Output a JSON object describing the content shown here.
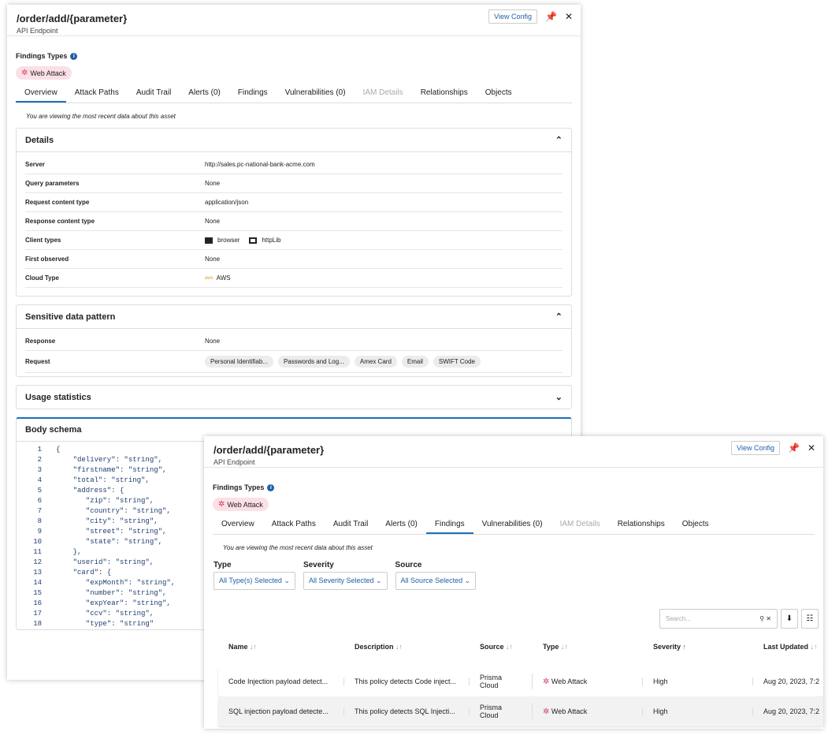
{
  "endpoint": {
    "title": "/order/add/{parameter}",
    "subtitle": "API Endpoint",
    "view_config": "View Config",
    "findings_types": "Findings Types",
    "chip": "Web Attack"
  },
  "tabs": [
    "Overview",
    "Attack Paths",
    "Audit Trail",
    "Alerts (0)",
    "Findings",
    "Vulnerabilities (0)",
    "IAM Details",
    "Relationships",
    "Objects"
  ],
  "note": "You are viewing the most recent data about this asset",
  "details": {
    "title": "Details",
    "rows": [
      {
        "k": "Server",
        "v": "http://sales.pc-national-bank-acme.com"
      },
      {
        "k": "Query parameters",
        "v": "None"
      },
      {
        "k": "Request content type",
        "v": "application/json"
      },
      {
        "k": "Response content type",
        "v": "None"
      },
      {
        "k": "Client types",
        "v": "browser",
        "v2": "httpLib"
      },
      {
        "k": "First observed",
        "v": "None"
      },
      {
        "k": "Cloud Type",
        "v": "AWS"
      }
    ]
  },
  "sensitive": {
    "title": "Sensitive data pattern",
    "response_label": "Response",
    "response": "None",
    "request_label": "Request",
    "request": [
      "Personal Identifiab...",
      "Passwords and Log...",
      "Amex Card",
      "Email",
      "SWIFT Code"
    ]
  },
  "usage": {
    "title": "Usage statistics"
  },
  "schema": {
    "title": "Body schema",
    "lines": [
      "{",
      "    \"delivery\": \"string\",",
      "    \"firstname\": \"string\",",
      "    \"total\": \"string\",",
      "    \"address\": {",
      "       \"zip\": \"string\",",
      "       \"country\": \"string\",",
      "       \"city\": \"string\",",
      "       \"street\": \"string\",",
      "       \"state\": \"string\",",
      "    },",
      "    \"userid\": \"string\",",
      "    \"card\": {",
      "       \"expMonth\": \"string\",",
      "       \"number\": \"string\",",
      "       \"expYear\": \"string\",",
      "       \"ccv\": \"string\",",
      "       \"type\": \"string\""
    ]
  },
  "filters": [
    {
      "label": "Type",
      "value": "All Type(s) Selected"
    },
    {
      "label": "Severity",
      "value": "All Severity Selected"
    },
    {
      "label": "Source",
      "value": "All Source Selected"
    }
  ],
  "search_placeholder": "Search...",
  "table": {
    "columns": [
      "Name",
      "Description",
      "Source",
      "Type",
      "Severity",
      "Last Updated"
    ],
    "rows": [
      [
        "Code Injection payload detect...",
        "This policy detects Code inject...",
        "Prisma Cloud",
        "Web Attack",
        "High",
        "Aug 20, 2023, 7:2"
      ],
      [
        "SQL injection payload detecte...",
        "This policy detects SQL Injecti...",
        "Prisma Cloud",
        "Web Attack",
        "High",
        "Aug 20, 2023, 7:2"
      ]
    ]
  },
  "colors": {
    "accent": "#1f6fb8",
    "chip_bg": "#fbe0e6",
    "web_attack": "#d23a5a"
  }
}
